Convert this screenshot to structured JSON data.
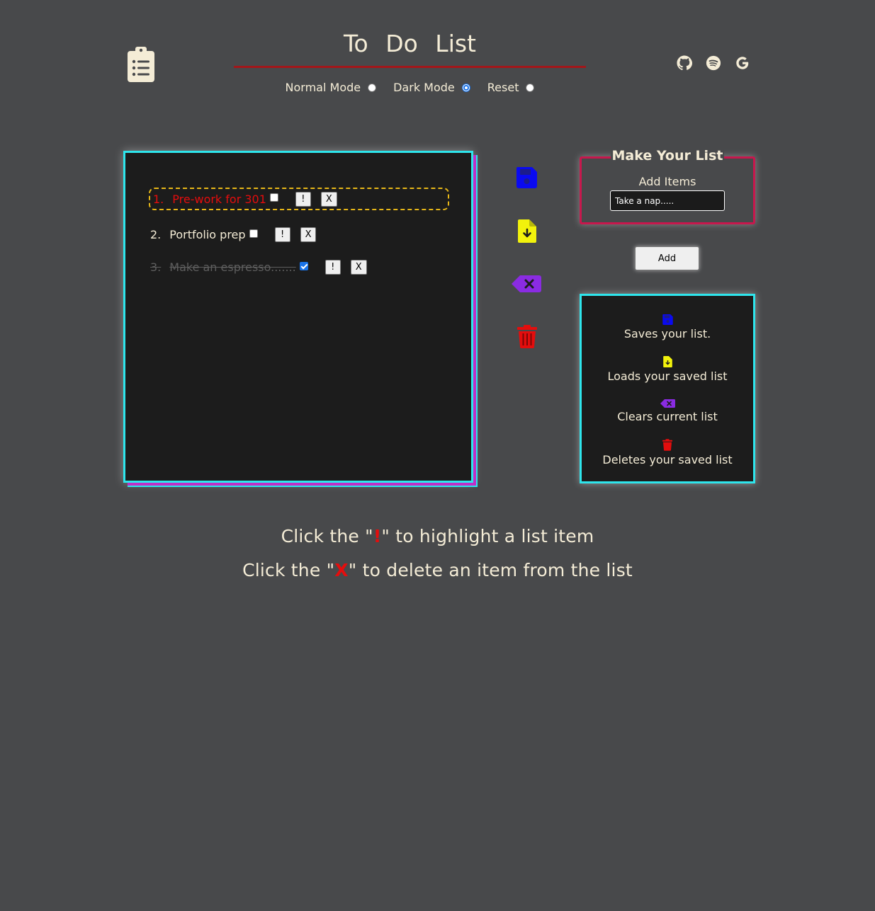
{
  "header": {
    "title": "To Do List",
    "modes": [
      {
        "label": "Normal Mode",
        "checked": false
      },
      {
        "label": "Dark Mode",
        "checked": true
      },
      {
        "label": "Reset",
        "checked": false
      }
    ],
    "social_icons": [
      "github-icon",
      "spotify-icon",
      "google-icon"
    ]
  },
  "list": {
    "items": [
      {
        "num": "1.",
        "text": "Pre-work for 301",
        "checked": false,
        "highlighted": true,
        "bang_label": "!",
        "delete_label": "X"
      },
      {
        "num": "2.",
        "text": "Portfolio prep",
        "checked": false,
        "highlighted": false,
        "bang_label": "!",
        "delete_label": "X"
      },
      {
        "num": "3.",
        "text": "Make an espresso.......",
        "checked": true,
        "highlighted": false,
        "bang_label": "!",
        "delete_label": "X"
      }
    ]
  },
  "actions": [
    "save-icon",
    "load-file-icon",
    "clear-backspace-icon",
    "trash-icon"
  ],
  "make_list": {
    "title": "Make Your List",
    "add_items_label": "Add Items",
    "input_value": "Take a nap.....",
    "add_button": "Add"
  },
  "legend": {
    "items": [
      {
        "icon": "save-icon",
        "text": "Saves your list."
      },
      {
        "icon": "load-file-icon",
        "text": "Loads your saved list"
      },
      {
        "icon": "clear-backspace-icon",
        "text": "Clears current list"
      },
      {
        "icon": "trash-icon",
        "text": "Deletes your saved list"
      }
    ]
  },
  "instructions": {
    "line1_pre": "Click the \"",
    "line1_sym": "!",
    "line1_post": "\" to highlight a list item",
    "line2_pre": "Click the \"",
    "line2_sym": "X",
    "line2_post": "\" to delete an item from the list"
  },
  "colors": {
    "background": "#48494b",
    "panel": "#1c1c1c",
    "cyan_border": "#2ee5ec",
    "red_border": "#c8174d",
    "title_rule": "#a3161a",
    "highlight_text": "#e40d0d",
    "highlight_border": "#e7b718",
    "save": "#0a0af0",
    "load": "#f2f20c",
    "clear": "#8a2be2",
    "trash": "#e40d0d"
  }
}
